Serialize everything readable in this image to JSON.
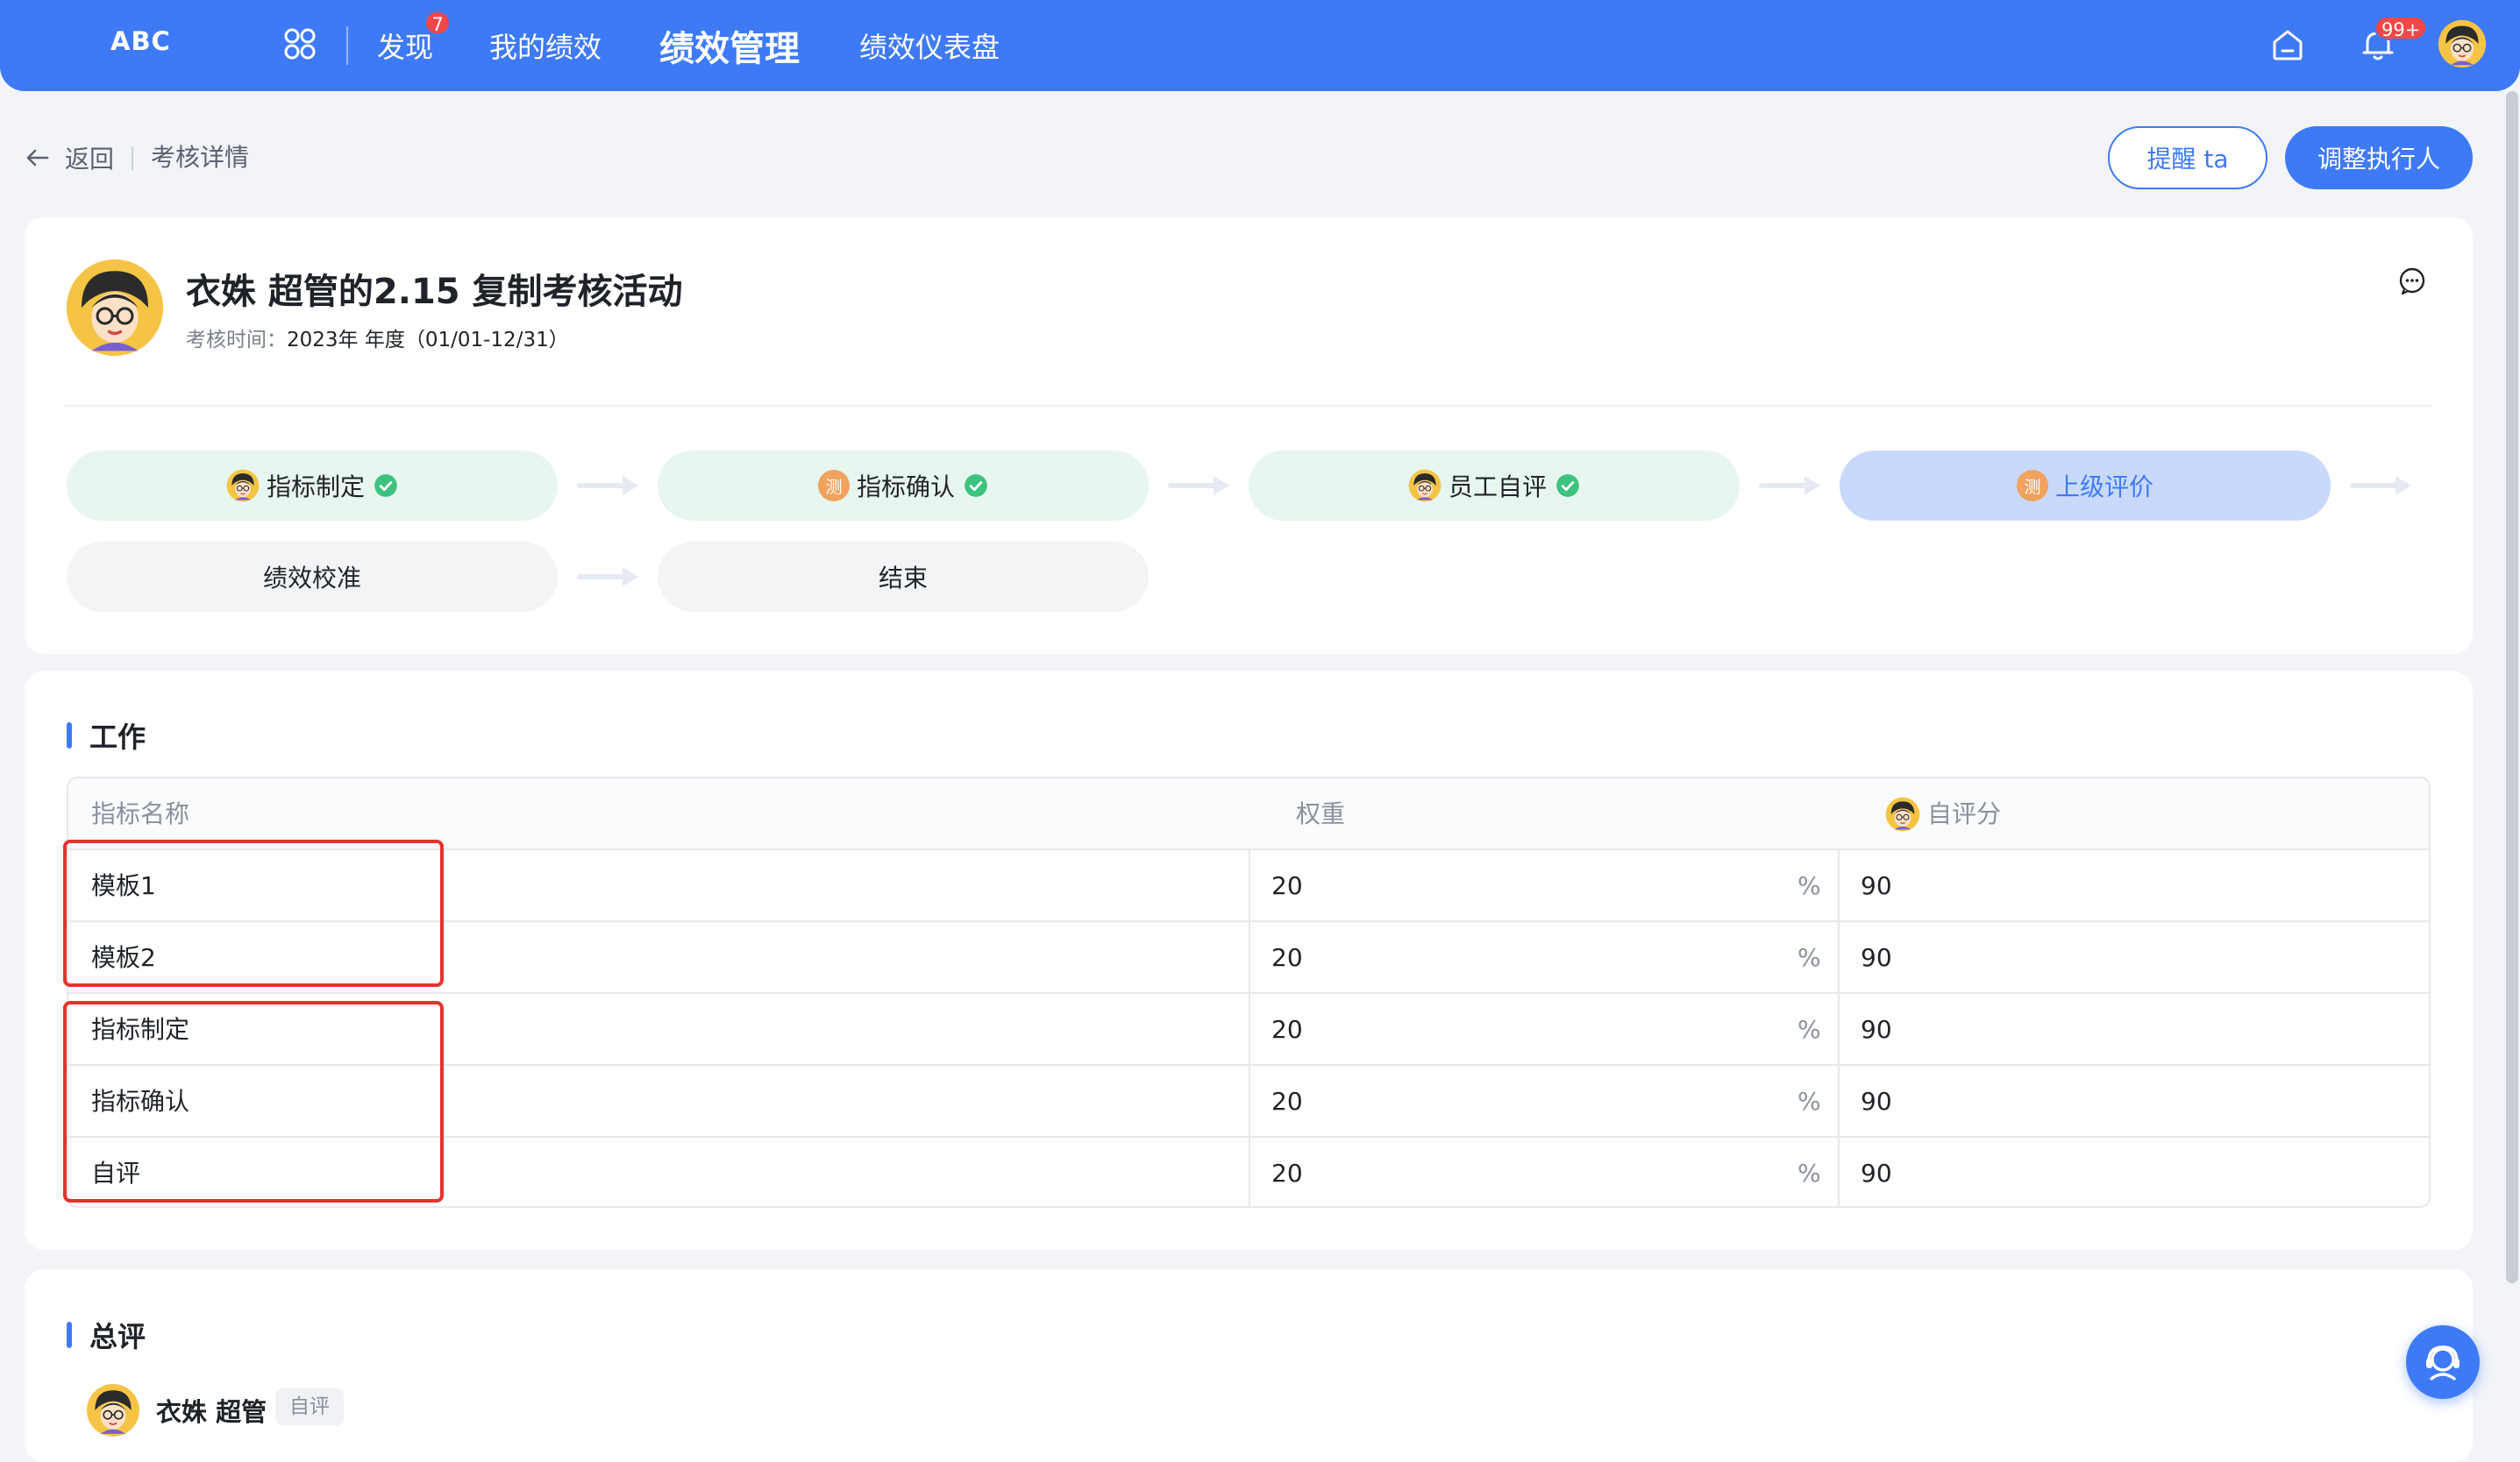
{
  "header": {
    "logo": "ABC",
    "nav": {
      "find": "发现",
      "find_badge": "7",
      "mine": "我的绩效",
      "mgmt": "绩效管理",
      "dashboard": "绩效仪表盘"
    },
    "bell_badge": "99+"
  },
  "subbar": {
    "back": "返回",
    "crumb": "考核详情",
    "remind_button": "提醒 ta",
    "adjust_button": "调整执行人"
  },
  "activity": {
    "title": "衣姝 超管的2.15 复制考核活动",
    "time_label": "考核时间：",
    "time_value": "2023年 年度（01/01-12/31）"
  },
  "steps": [
    {
      "label": "指标制定",
      "status": "done"
    },
    {
      "label": "指标确认",
      "status": "done",
      "badge": "测"
    },
    {
      "label": "员工自评",
      "status": "done"
    },
    {
      "label": "上级评价",
      "status": "active",
      "badge": "测"
    },
    {
      "label": "绩效校准",
      "status": "todo"
    },
    {
      "label": "结束",
      "status": "todo"
    }
  ],
  "work": {
    "section_title": "工作",
    "columns": {
      "name": "指标名称",
      "weight": "权重",
      "self_score": "自评分"
    },
    "rows": [
      {
        "name": "模板1",
        "weight": "20",
        "unit": "%",
        "score": "90"
      },
      {
        "name": "模板2",
        "weight": "20",
        "unit": "%",
        "score": "90"
      },
      {
        "name": "指标制定",
        "weight": "20",
        "unit": "%",
        "score": "90"
      },
      {
        "name": "指标确认",
        "weight": "20",
        "unit": "%",
        "score": "90"
      },
      {
        "name": "自评",
        "weight": "20",
        "unit": "%",
        "score": "90"
      }
    ]
  },
  "summary": {
    "section_title": "总评",
    "name": "衣姝 超管",
    "tag": "自评"
  },
  "colors": {
    "primary": "#3f7af6",
    "done_bg": "#e7f6ee",
    "active_bg": "#c9d9fc",
    "highlight": "#e5322d"
  }
}
